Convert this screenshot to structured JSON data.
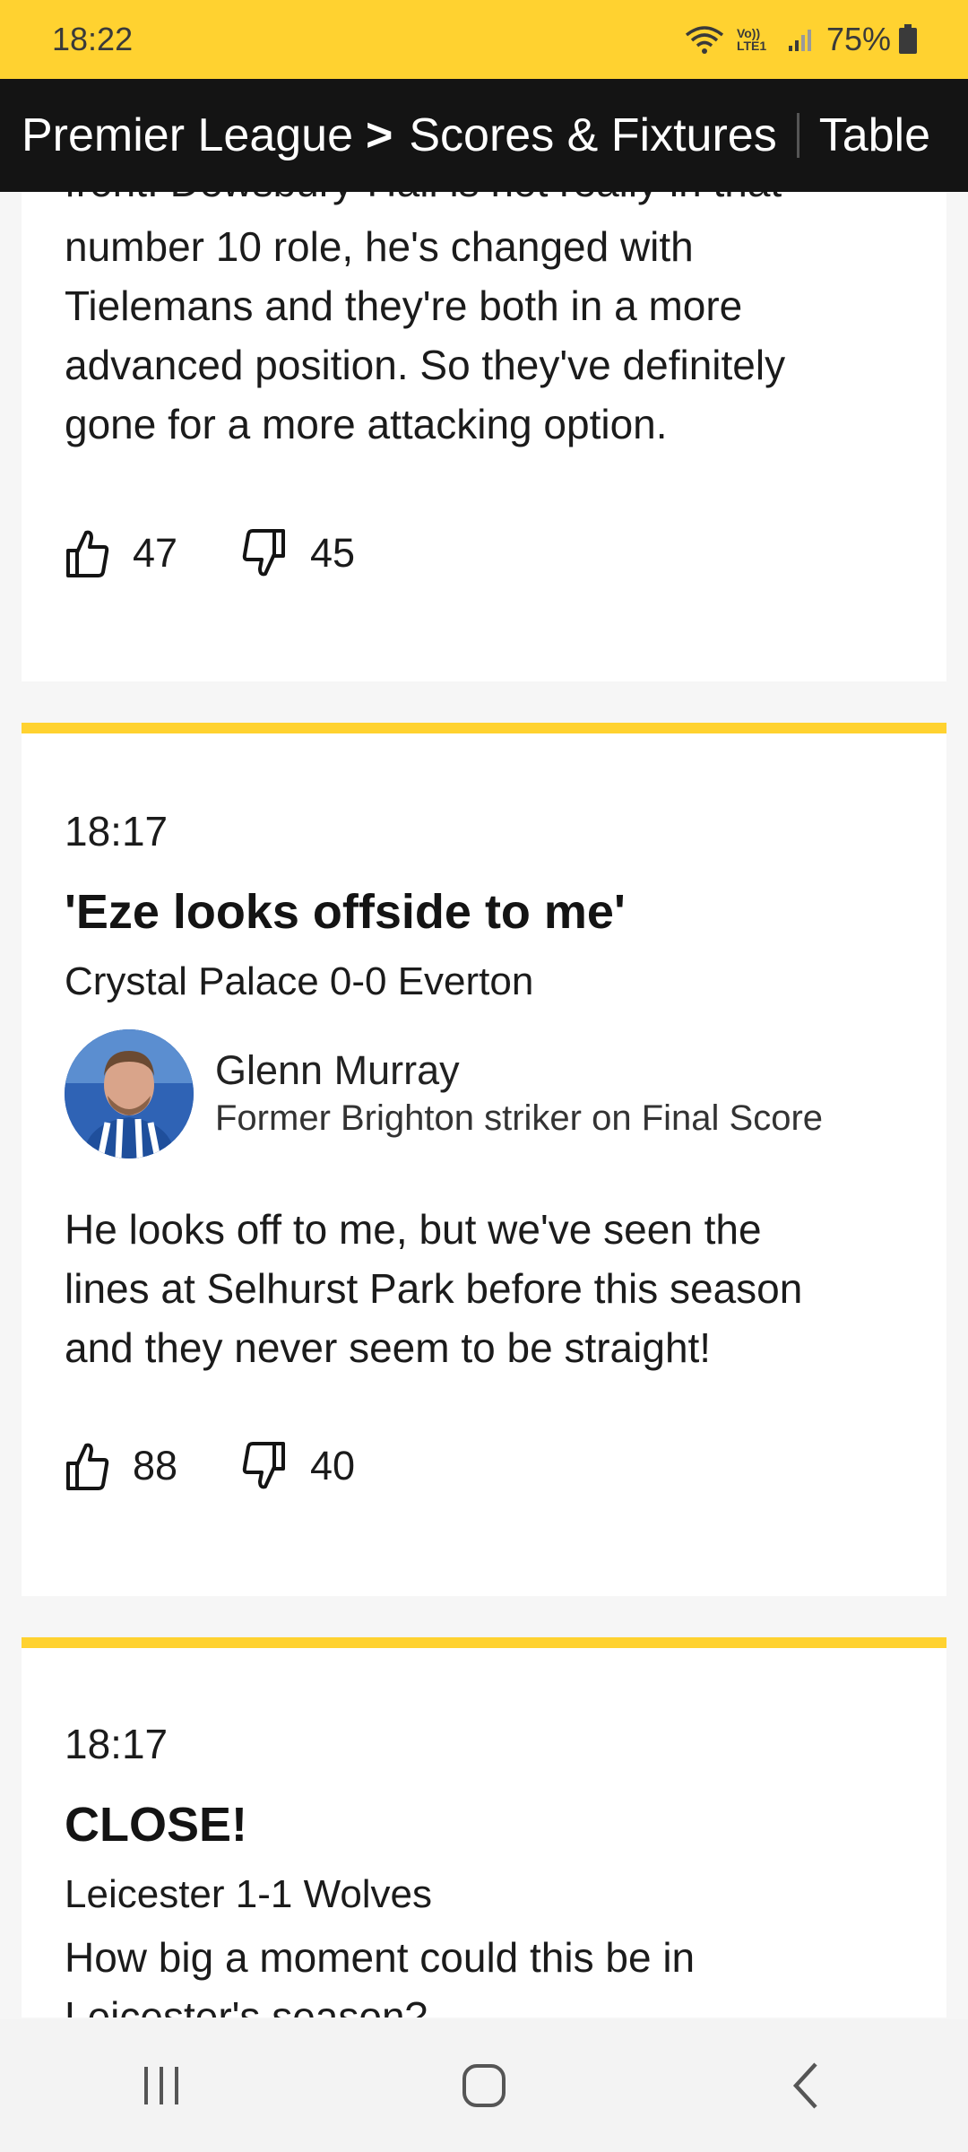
{
  "status": {
    "time": "18:22",
    "volte": "Vo)) LTE1",
    "battery": "75%"
  },
  "header": {
    "crumb": "Premier League",
    "active": "Scores & Fixtures",
    "next": "Table"
  },
  "entries": [
    {
      "partial_line": "front. Dewsbury-Hall is not really in that",
      "body_lines": [
        "number 10 role, he's changed with",
        "Tielemans and they're both in a more",
        "advanced position. So they've definitely",
        "gone for a more attacking option."
      ],
      "likes": "47",
      "dislikes": "45"
    },
    {
      "time": "18:17",
      "headline": "'Eze looks offside to me'",
      "subhead": "Crystal Palace 0-0 Everton",
      "contributor": {
        "name": "Glenn Murray",
        "role": "Former Brighton striker on Final Score"
      },
      "body_lines": [
        "He looks off to me, but we've seen the",
        "lines at Selhurst Park before this season",
        "and they never seem to be straight!"
      ],
      "likes": "88",
      "dislikes": "40"
    },
    {
      "time": "18:17",
      "headline": "CLOSE!",
      "subhead": "Leicester 1-1 Wolves",
      "body_lines": [
        "How big a moment could this be in",
        "Leicester's season?"
      ]
    }
  ],
  "icons": {
    "like": "thumbs-up-icon",
    "dislike": "thumbs-down-icon",
    "recents": "recent-apps-icon",
    "home": "home-icon",
    "back": "back-icon"
  },
  "colors": {
    "accent": "#ffd230",
    "header_bg": "#141414",
    "card_bg": "#ffffff",
    "page_bg": "#f6f6f6"
  }
}
